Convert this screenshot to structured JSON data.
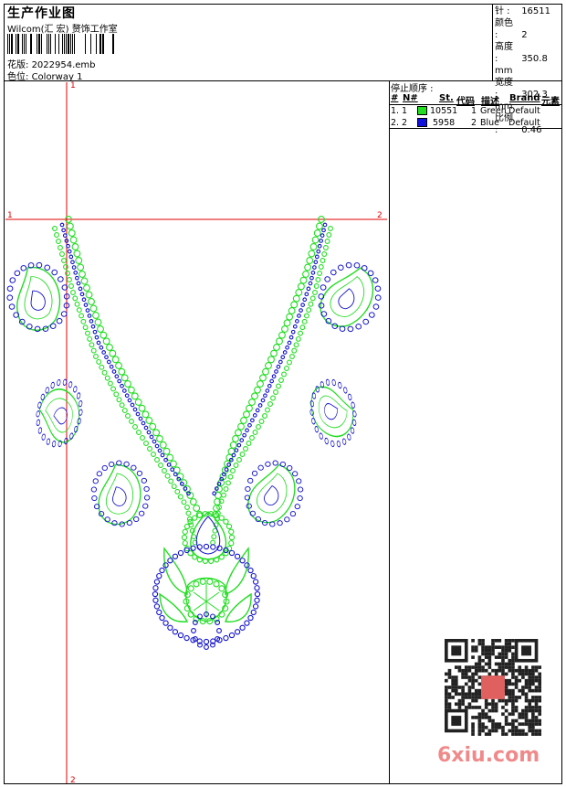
{
  "header": {
    "title": "生产作业图",
    "company": "Wilcom(汇 宏) 赘饰工作室",
    "design_label": "花版:",
    "design_file": "2022954.emb",
    "colorway_label": "色位:",
    "colorway": "Colorway 1"
  },
  "stats": [
    {
      "label": "针 :",
      "value": "16511"
    },
    {
      "label": "颜色 :",
      "value": "2"
    },
    {
      "label": "高度 :",
      "value": "350.8 mm"
    },
    {
      "label": "宽度 :",
      "value": "302.3 mm"
    },
    {
      "label": "比例 :",
      "value": "0.46"
    }
  ],
  "stop_sequence": {
    "title": "停止顺序 :",
    "headers": {
      "idx": "#",
      "no": "N#",
      "st": "St.",
      "code": "代码",
      "desc": "描述",
      "brand": "Brand",
      "element": "元素"
    },
    "rows": [
      {
        "idx": "1.",
        "no": "1",
        "stitches": "10551",
        "code": "1",
        "desc": "Green",
        "brand": "Default",
        "color": "#22dd22"
      },
      {
        "idx": "2.",
        "no": "2",
        "stitches": "5958",
        "code": "2",
        "desc": "Blue",
        "brand": "Default",
        "color": "#1111dd"
      }
    ]
  },
  "guides": {
    "v_top": "1",
    "v_bottom": "2",
    "h_left": "1",
    "h_right": "2"
  },
  "watermark": "6xiu.com",
  "colors": {
    "green": "#22dd22",
    "blue": "#1111cc",
    "guide": "#e00000"
  }
}
